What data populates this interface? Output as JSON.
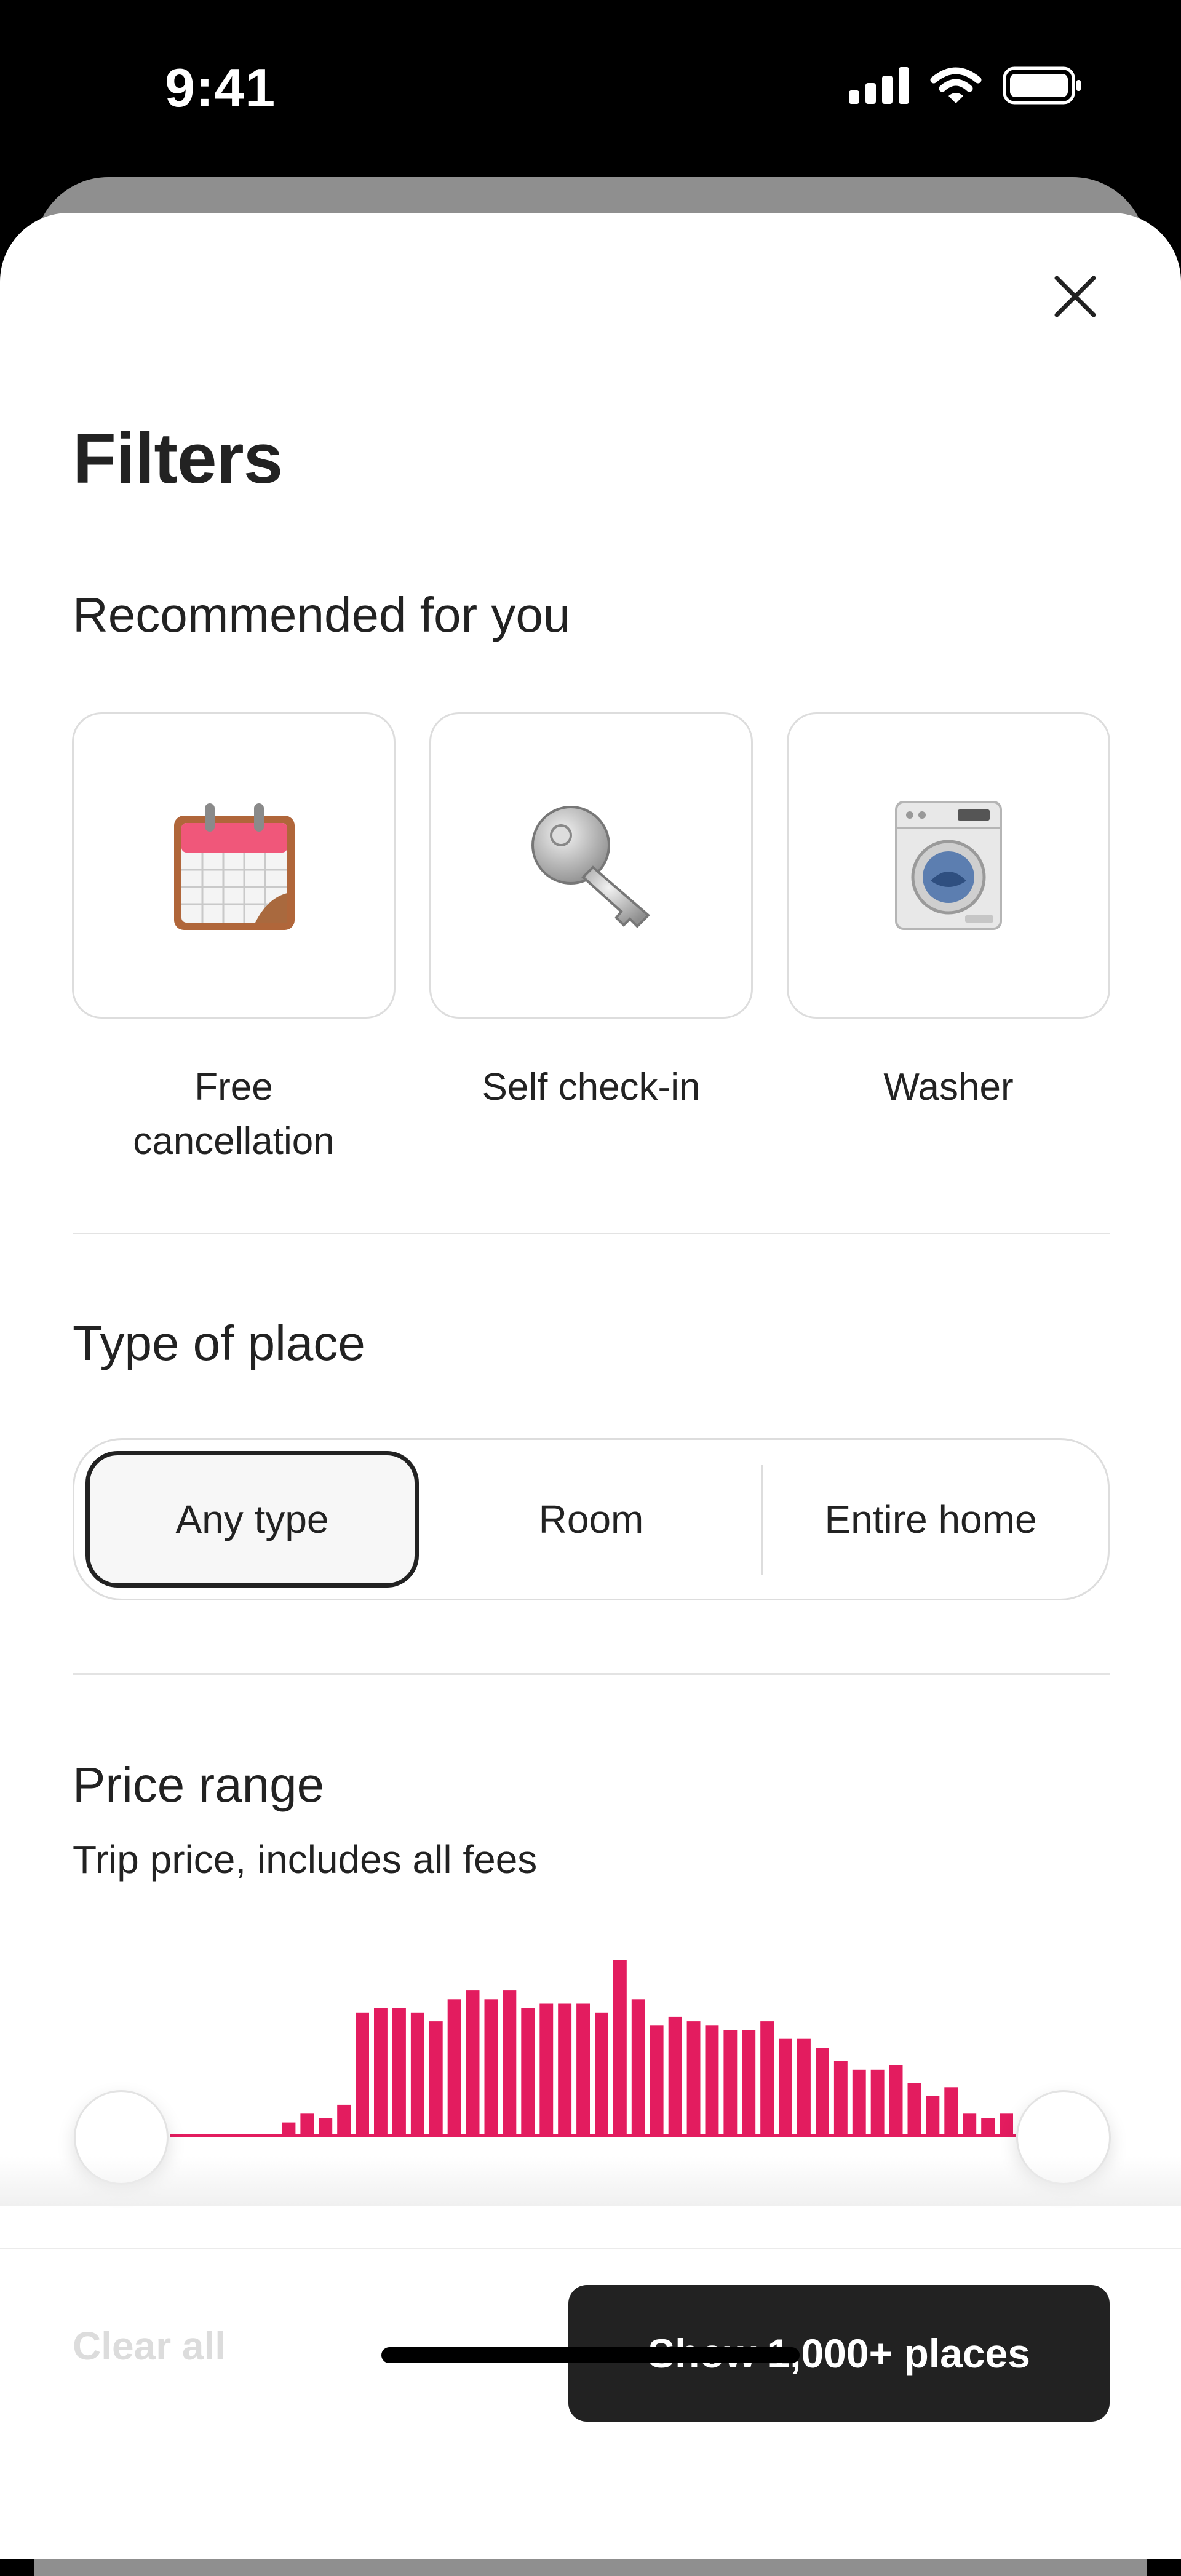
{
  "status_bar": {
    "time": "9:41"
  },
  "filters": {
    "title": "Filters",
    "recommended": {
      "title": "Recommended for you",
      "items": [
        {
          "label": "Free cancellation",
          "icon": "calendar-icon"
        },
        {
          "label": "Self check-in",
          "icon": "key-icon"
        },
        {
          "label": "Washer",
          "icon": "washer-icon"
        }
      ]
    },
    "type_of_place": {
      "title": "Type of place",
      "options": [
        "Any type",
        "Room",
        "Entire home"
      ],
      "selected": "Any type"
    },
    "price_range": {
      "title": "Price range",
      "subtitle": "Trip price, includes all fees",
      "histogram": [
        0,
        0,
        0,
        0,
        0,
        0,
        6,
        10,
        8,
        14,
        56,
        58,
        58,
        56,
        52,
        62,
        66,
        62,
        66,
        58,
        60,
        60,
        60,
        56,
        80,
        62,
        50,
        54,
        52,
        50,
        48,
        48,
        52,
        44,
        44,
        40,
        34,
        30,
        30,
        32,
        24,
        18,
        22,
        10,
        8,
        10
      ],
      "accent_color": "#E31C5F"
    },
    "footer": {
      "clear_all": "Clear all",
      "show_button": "Show 1,000+ places"
    }
  }
}
